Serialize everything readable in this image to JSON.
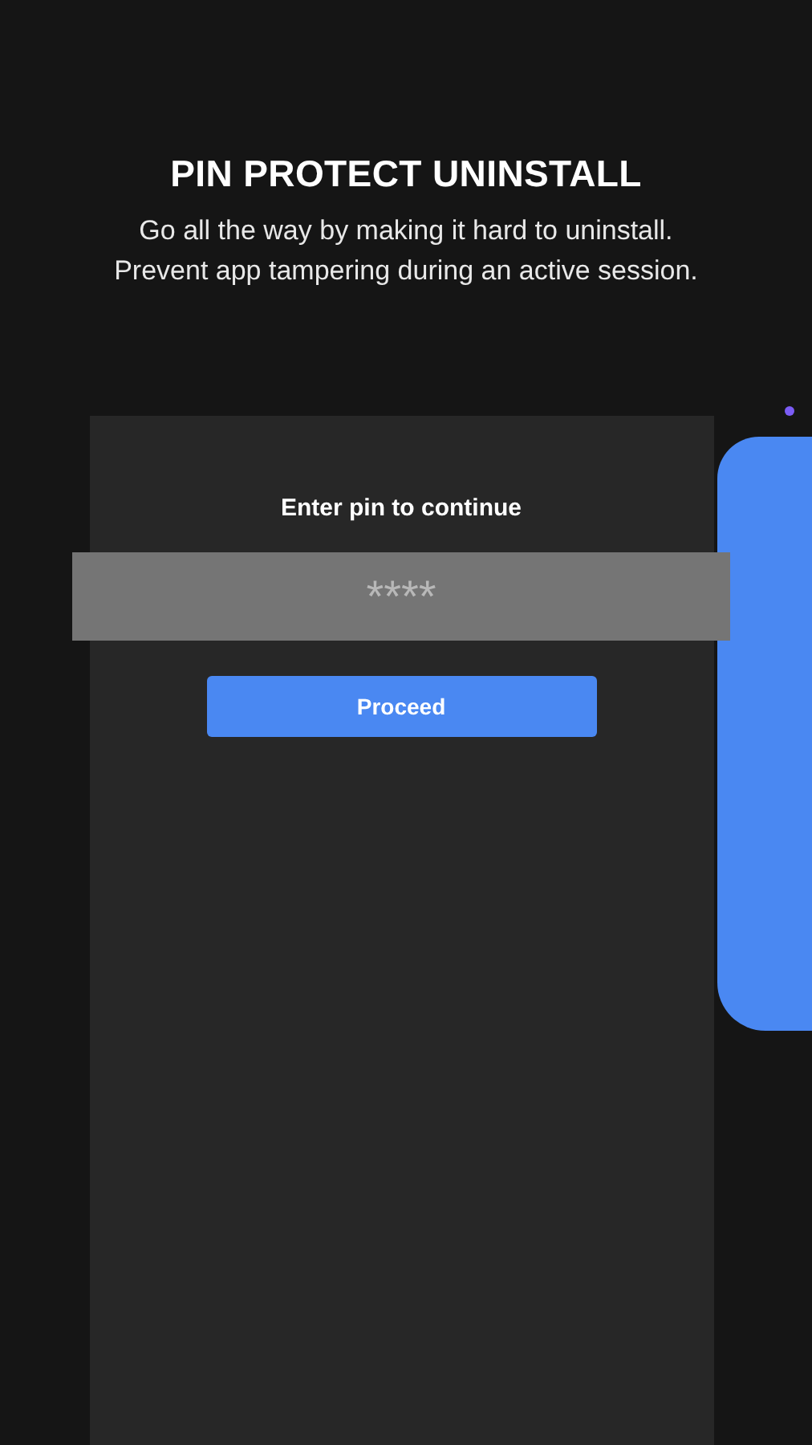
{
  "header": {
    "title": "PIN PROTECT UNINSTALL",
    "subtitle_lines": [
      "Go all the way by making it hard to uninstall.",
      "Prevent app tampering during an active session."
    ]
  },
  "pin_dialog": {
    "prompt": "Enter pin to continue",
    "pin_field": {
      "placeholder": "****"
    },
    "button": "Proceed"
  }
}
